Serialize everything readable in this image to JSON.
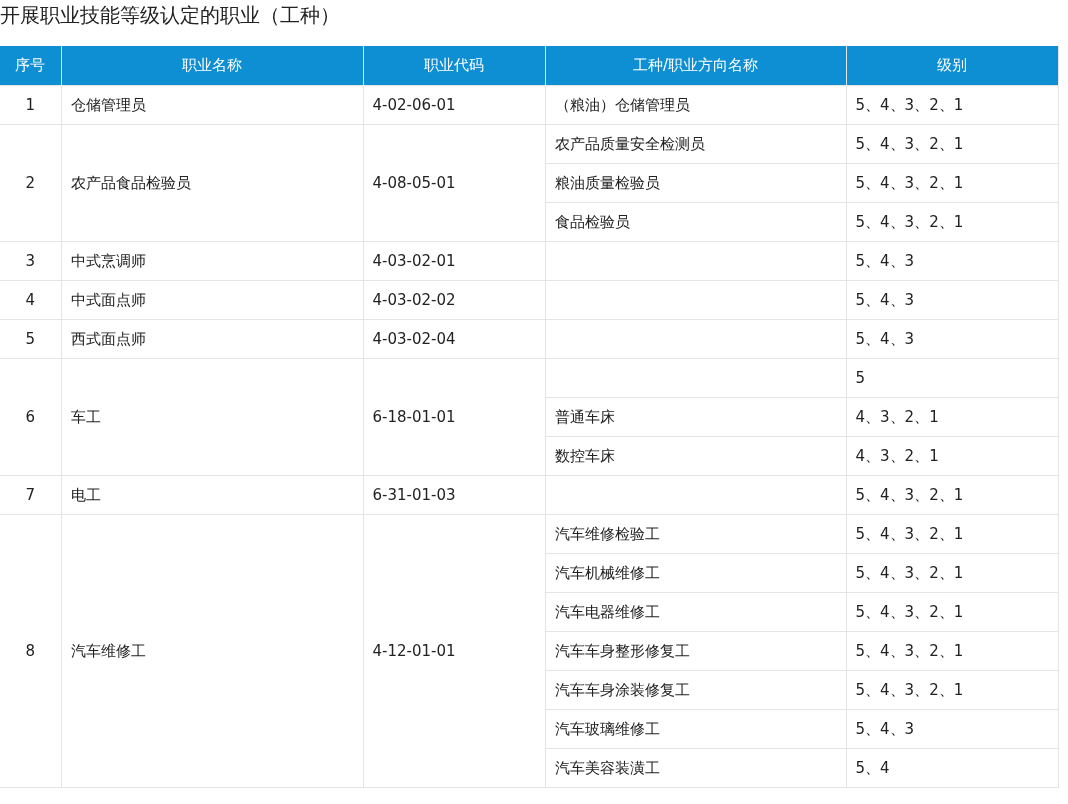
{
  "title": "开展职业技能等级认定的职业（工种）",
  "table": {
    "columns": [
      "序号",
      "职业名称",
      "职业代码",
      "工种/职业方向名称",
      "级别"
    ],
    "rows": [
      {
        "no": "1",
        "name": "仓储管理员",
        "code": "4-02-06-01",
        "directions": [
          {
            "direction": "（粮油）仓储管理员",
            "levels": "5、4、3、2、1"
          }
        ]
      },
      {
        "no": "2",
        "name": "农产品食品检验员",
        "code": "4-08-05-01",
        "directions": [
          {
            "direction": "农产品质量安全检测员",
            "levels": "5、4、3、2、1"
          },
          {
            "direction": "粮油质量检验员",
            "levels": "5、4、3、2、1"
          },
          {
            "direction": "食品检验员",
            "levels": "5、4、3、2、1"
          }
        ]
      },
      {
        "no": "3",
        "name": "中式烹调师",
        "code": "4-03-02-01",
        "directions": [
          {
            "levels": "5、4、3"
          }
        ]
      },
      {
        "no": "4",
        "name": "中式面点师",
        "code": "4-03-02-02",
        "directions": [
          {
            "levels": "5、4、3"
          }
        ]
      },
      {
        "no": "5",
        "name": "西式面点师",
        "code": "4-03-02-04",
        "directions": [
          {
            "levels": "5、4、3"
          }
        ]
      },
      {
        "no": "6",
        "name": "车工",
        "code": "6-18-01-01",
        "directions": [
          {
            "levels": "5"
          },
          {
            "direction": "普通车床",
            "levels": "4、3、2、1"
          },
          {
            "direction": "数控车床",
            "levels": "4、3、2、1"
          }
        ]
      },
      {
        "no": "7",
        "name": "电工",
        "code": "6-31-01-03",
        "directions": [
          {
            "levels": "5、4、3、2、1"
          }
        ]
      },
      {
        "no": "8",
        "name": "汽车维修工",
        "code": "4-12-01-01",
        "directions": [
          {
            "direction": "汽车维修检验工",
            "levels": "5、4、3、2、1"
          },
          {
            "direction": "汽车机械维修工",
            "levels": "5、4、3、2、1"
          },
          {
            "direction": "汽车电器维修工",
            "levels": "5、4、3、2、1"
          },
          {
            "direction": "汽车车身整形修复工",
            "levels": "5、4、3、2、1"
          },
          {
            "direction": "汽车车身涂装修复工",
            "levels": "5、4、3、2、1"
          },
          {
            "direction": "汽车玻璃维修工",
            "levels": "5、4、3"
          },
          {
            "direction": "汽车美容装潢工",
            "levels": "5、4"
          }
        ]
      }
    ]
  }
}
